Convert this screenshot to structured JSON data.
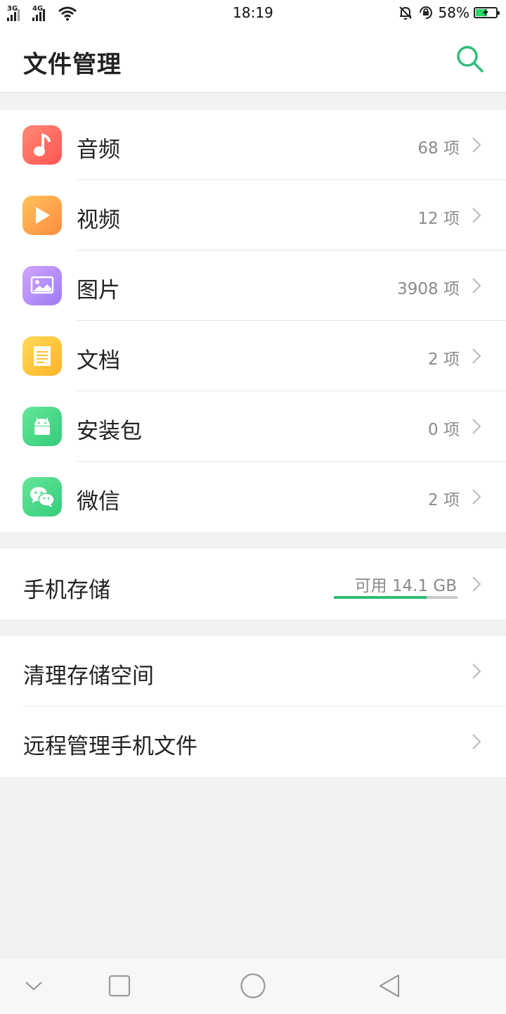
{
  "status_bar": {
    "net1": "3G",
    "net2": "4G",
    "time": "18:19",
    "battery_pct": "58%",
    "battery_level": 0.58
  },
  "header": {
    "title": "文件管理",
    "search_icon": "search-icon",
    "accent_color": "#2dbd79"
  },
  "categories": [
    {
      "label": "音频",
      "count": "68 项",
      "icon": "music-note-icon",
      "color_from": "#ff7d6b",
      "color_to": "#ff5a55"
    },
    {
      "label": "视频",
      "count": "12 项",
      "icon": "play-icon",
      "color_from": "#ffb956",
      "color_to": "#ff8f42"
    },
    {
      "label": "图片",
      "count": "3908 项",
      "icon": "image-icon",
      "color_from": "#c79bff",
      "color_to": "#9f7cf5"
    },
    {
      "label": "文档",
      "count": "2 项",
      "icon": "document-icon",
      "color_from": "#ffd44d",
      "color_to": "#ffb626"
    },
    {
      "label": "安装包",
      "count": "0 项",
      "icon": "android-icon",
      "color_from": "#5ee394",
      "color_to": "#35cf7b"
    },
    {
      "label": "微信",
      "count": "2 项",
      "icon": "wechat-icon",
      "color_from": "#5ee394",
      "color_to": "#35cf7b"
    }
  ],
  "storage": {
    "label": "手机存储",
    "available": "可用 14.1 GB",
    "used_fraction": 0.75
  },
  "tools": [
    {
      "label": "清理存储空间"
    },
    {
      "label": "远程管理手机文件"
    }
  ],
  "nav": {
    "icons": [
      "chevron-down-icon",
      "recent-apps-icon",
      "home-icon",
      "back-icon"
    ]
  }
}
